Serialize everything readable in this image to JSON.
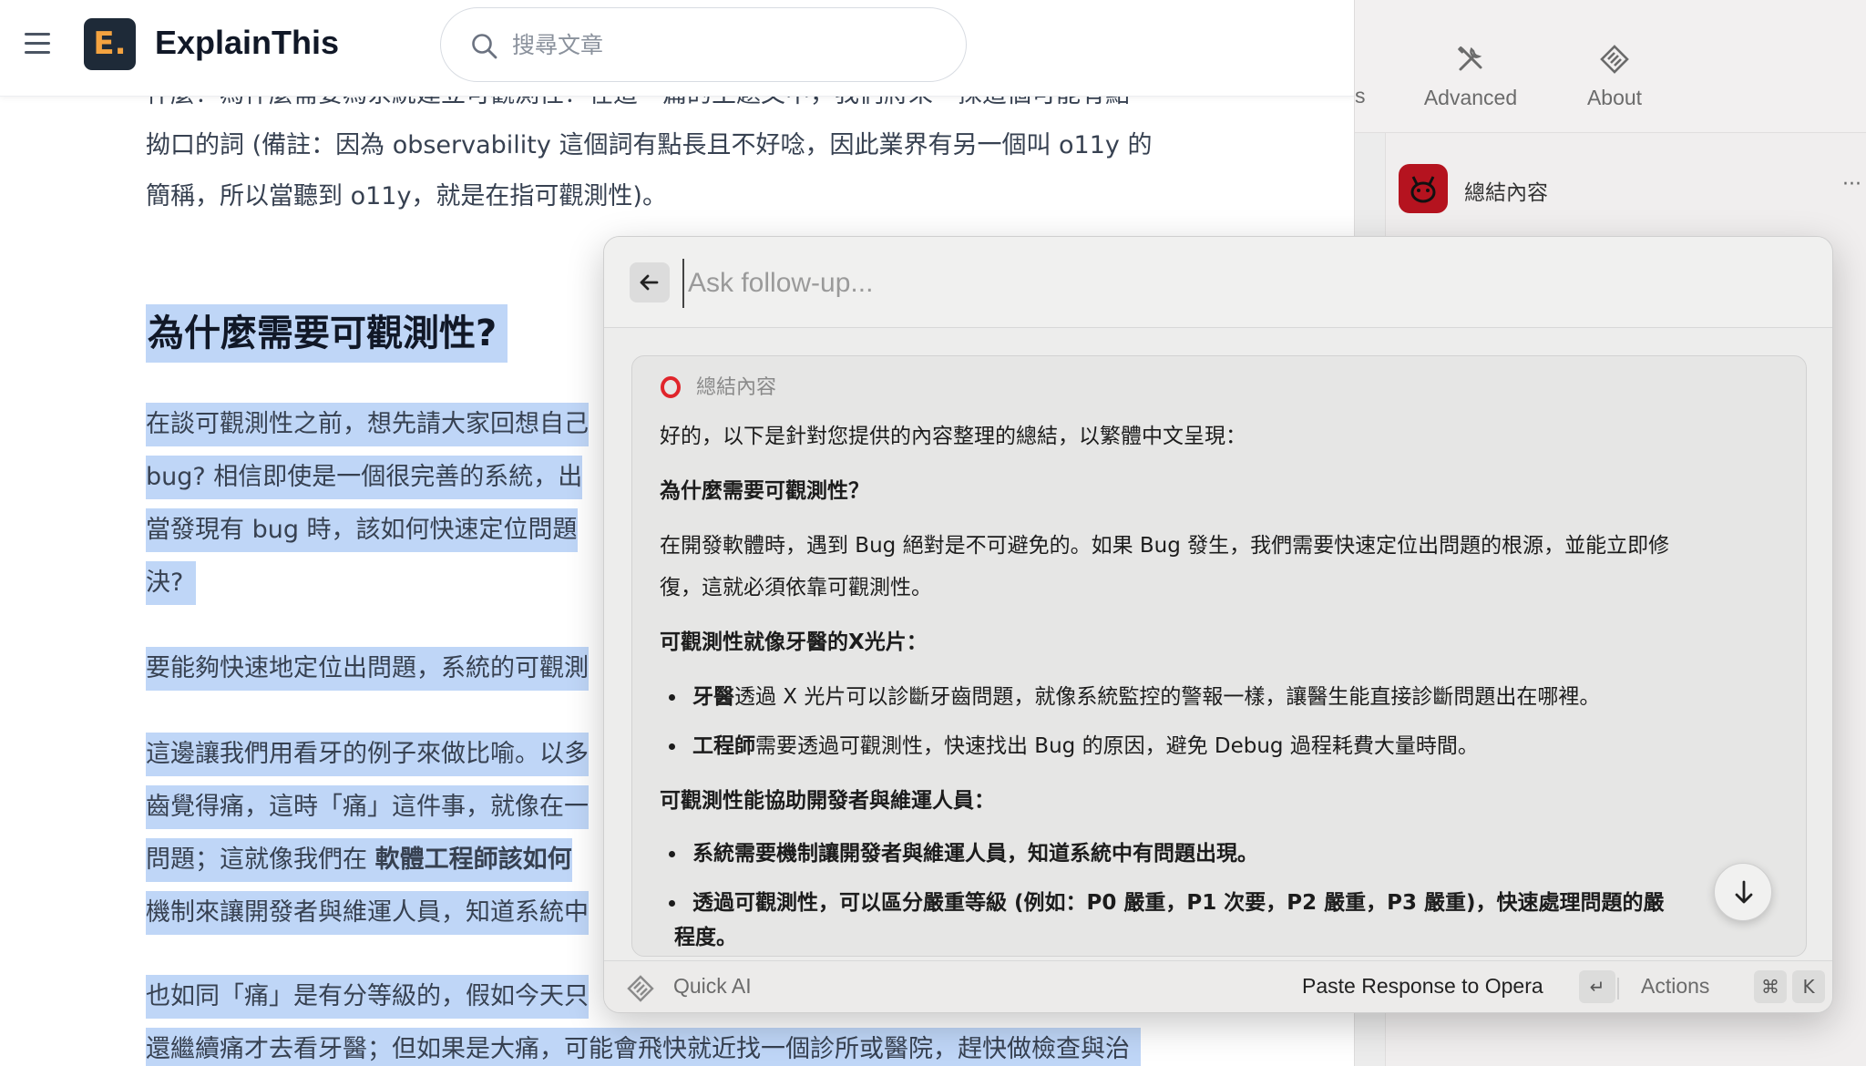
{
  "browser": {
    "brand": "ExplainThis",
    "logo_letter": "E.",
    "search": {
      "placeholder": "搜尋文章"
    }
  },
  "article": {
    "lines_top": [
      "什麼？為什麼需要為系統建立可觀測性？在這一篇的主題文中，我們將來一探這個可能有點",
      "拗口的詞 (備註：因為 observability 這個詞有點長且不好唸，因此業界有另一個叫 o11y 的",
      "簡稱，所以當聽到 o11y，就是在指可觀測性)。"
    ],
    "heading": "為什麼需要可觀測性?",
    "para1": [
      "在談可觀測性之前，想先請大家回想自己",
      "bug? 相信即使是一個很完善的系統，出",
      "當發現有 bug 時，該如何快速定位問題",
      "決?"
    ],
    "para2": "要能夠快速地定位出問題，系統的可觀測",
    "para3": [
      "這邊讓我們用看牙的例子來做比喻。以多",
      "齒覺得痛，這時「痛」這件事，就像在一",
      "機制來讓開發者與維運人員，知道系統中"
    ],
    "para3_line3_prefix": "問題；這就像我們在 ",
    "para3_line3_bold": "軟體工程師該如何",
    "para4": [
      "也如同「痛」是有分等級的，假如今天只",
      "還繼續痛才去看牙醫；但如果是大痛，可能會飛快就近找一個診所或醫院，趕快做檢查與治"
    ]
  },
  "backdrop": {
    "partial_tab": "s",
    "tabs": [
      {
        "label": "Advanced",
        "icon": "tools-icon"
      },
      {
        "label": "About",
        "icon": "raycast-logo-icon"
      }
    ],
    "row_label": "總結內容",
    "row_more": "···"
  },
  "panel": {
    "followup_placeholder": "Ask follow-up...",
    "source_label": "總結內容",
    "response": {
      "intro": "好的，以下是針對您提供的內容整理的總結，以繁體中文呈現：",
      "h1": "為什麼需要可觀測性？",
      "p1_line1": "在開發軟體時，遇到 Bug 絕對是不可避免的。如果 Bug 發生，我們需要快速定位出問題的根源，並能立即修",
      "p1_line2": "復，這就必須依靠可觀測性。",
      "h2": "可觀測性就像牙醫的X光片：",
      "b1_bold": "牙醫",
      "b1_rest": "透過 X 光片可以診斷牙齒問題，就像系統監控的警報一樣，讓醫生能直接診斷問題出在哪裡。",
      "b2_bold": "工程師",
      "b2_rest": "需要透過可觀測性，快速找出 Bug 的原因，避免 Debug 過程耗費大量時間。",
      "h3": "可觀測性能協助開發者與維運人員：",
      "b3": "系統需要機制讓開發者與維運人員，知道系統中有問題出現。",
      "b4": "透過可觀測性，可以區分嚴重等級 (例如：P0 嚴重，P1 次要，P2 嚴重，P3 嚴重)，快速處理問題的嚴",
      "b4_cont": "程度。"
    },
    "footer": {
      "app_name": "Quick AI",
      "paste_label": "Paste Response to Opera",
      "enter_key": "↵",
      "actions_label": "Actions",
      "cmd_key": "⌘",
      "k_key": "K"
    }
  },
  "colors": {
    "highlight": "#bfd6f7",
    "logo_bg": "#1e2a38",
    "logo_fg": "#f4a340",
    "opera_red": "#e0252b"
  }
}
